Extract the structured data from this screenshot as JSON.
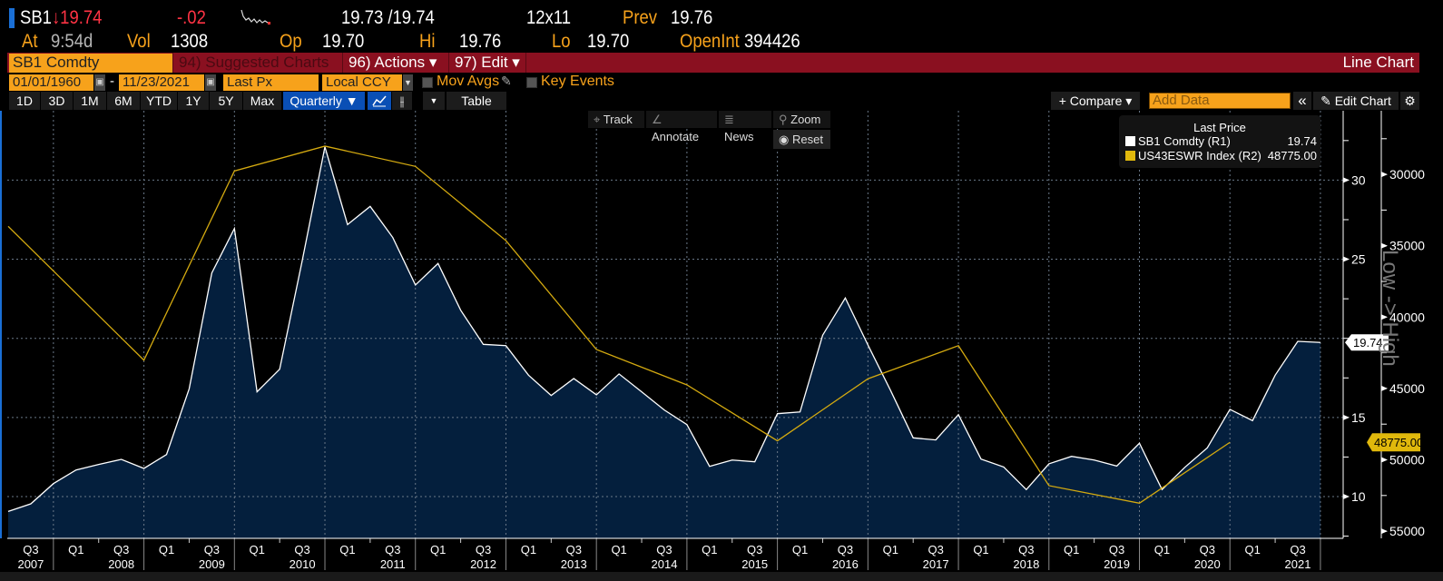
{
  "quote": {
    "ticker": "SB1",
    "arrow": "↓",
    "last": "19.74",
    "change": "-.02",
    "bid_ask": "19.73 /19.74",
    "size": "12x11",
    "prev_label": "Prev",
    "prev": "19.76",
    "at_label": "At",
    "time": "9:54d",
    "vol_label": "Vol",
    "vol": "1308",
    "op_label": "Op",
    "op": "19.70",
    "hi_label": "Hi",
    "hi": "19.76",
    "lo_label": "Lo",
    "lo": "19.70",
    "openint_label": "OpenInt",
    "openint": "394426"
  },
  "menubar": {
    "security": "SB1 Comdty",
    "suggested": "94) Suggested Charts",
    "actions": "96) Actions ▾",
    "edit": "97) Edit ▾",
    "chart_type": "Line Chart"
  },
  "settings": {
    "start_date": "01/01/1960",
    "dash": "-",
    "end_date": "11/23/2021",
    "field": "Last Px",
    "currency": "Local CCY",
    "mov_avgs": "Mov Avgs",
    "key_events": "Key Events"
  },
  "periods": [
    "1D",
    "3D",
    "1M",
    "6M",
    "YTD",
    "1Y",
    "5Y",
    "Max"
  ],
  "frequency": "Quarterly ▼",
  "table_label": "Table",
  "compare_label": "+ Compare ▾",
  "add_data_placeholder": "Add Data",
  "collapse_label": "«",
  "edit_chart_label": "Edit Chart",
  "chart_tools": {
    "track": "Track",
    "annotate": "Annotate",
    "news": "News",
    "zoom": "Zoom",
    "reset": "Reset"
  },
  "legend": {
    "title": "Last Price",
    "items": [
      {
        "name": "SB1 Comdty  (R1)",
        "value": "19.74",
        "color": "#ffffff"
      },
      {
        "name": "US43ESWR Index  (R2)",
        "value": "48775.00",
        "color": "#e0b80c"
      }
    ]
  },
  "colors": {
    "accent_orange": "#f7a21b",
    "bar_red": "#8a1020",
    "area_fill": "#041f3d",
    "r1_line": "#ffffff",
    "r2_line": "#d4aa10",
    "selected_blue": "#0a4fb5"
  },
  "chart_data": {
    "type": "line",
    "grid": true,
    "legend_placement": "top-right",
    "x_ticks": [
      {
        "q": "Q3",
        "year": "2007"
      },
      {
        "q": "Q1",
        "year": "2008"
      },
      {
        "q": "Q3",
        "year": ""
      },
      {
        "q": "Q1",
        "year": "2009"
      },
      {
        "q": "Q3",
        "year": ""
      },
      {
        "q": "Q1",
        "year": "2010"
      },
      {
        "q": "Q3",
        "year": ""
      },
      {
        "q": "Q1",
        "year": "2011"
      },
      {
        "q": "Q3",
        "year": ""
      },
      {
        "q": "Q1",
        "year": "2012"
      },
      {
        "q": "Q3",
        "year": ""
      },
      {
        "q": "Q1",
        "year": "2013"
      },
      {
        "q": "Q3",
        "year": ""
      },
      {
        "q": "Q1",
        "year": "2014"
      },
      {
        "q": "Q3",
        "year": ""
      },
      {
        "q": "Q1",
        "year": "2015"
      },
      {
        "q": "Q3",
        "year": ""
      },
      {
        "q": "Q1",
        "year": "2016"
      },
      {
        "q": "Q3",
        "year": ""
      },
      {
        "q": "Q1",
        "year": "2017"
      },
      {
        "q": "Q3",
        "year": ""
      },
      {
        "q": "Q1",
        "year": "2018"
      },
      {
        "q": "Q3",
        "year": ""
      },
      {
        "q": "Q1",
        "year": "2019"
      },
      {
        "q": "Q3",
        "year": ""
      },
      {
        "q": "Q1",
        "year": "2020"
      },
      {
        "q": "Q3",
        "year": ""
      },
      {
        "q": "Q1",
        "year": "2021"
      },
      {
        "q": "Q3",
        "year": ""
      }
    ],
    "r1_axis": {
      "ticks": [
        "30",
        "25",
        "15",
        "10"
      ],
      "ylim": [
        7.5,
        32.5
      ]
    },
    "r2_axis": {
      "ticks": [
        "30000",
        "35000",
        "40000",
        "45000",
        "50000",
        "55000"
      ],
      "inverted": true,
      "label": "Low -> High"
    },
    "series": [
      {
        "name": "SB1 Comdty (R1)",
        "axis": "R1",
        "style": "area",
        "last_tag": "19.74",
        "x": [
          "2007-Q2",
          "2007-Q3",
          "2007-Q4",
          "2008-Q1",
          "2008-Q2",
          "2008-Q3",
          "2008-Q4",
          "2009-Q1",
          "2009-Q2",
          "2009-Q3",
          "2009-Q4",
          "2010-Q1",
          "2010-Q2",
          "2010-Q3",
          "2010-Q4",
          "2011-Q1",
          "2011-Q2",
          "2011-Q3",
          "2011-Q4",
          "2012-Q1",
          "2012-Q2",
          "2012-Q3",
          "2012-Q4",
          "2013-Q1",
          "2013-Q2",
          "2013-Q3",
          "2013-Q4",
          "2014-Q1",
          "2014-Q2",
          "2014-Q3",
          "2014-Q4",
          "2015-Q1",
          "2015-Q2",
          "2015-Q3",
          "2015-Q4",
          "2016-Q1",
          "2016-Q2",
          "2016-Q3",
          "2016-Q4",
          "2017-Q1",
          "2017-Q2",
          "2017-Q3",
          "2017-Q4",
          "2018-Q1",
          "2018-Q2",
          "2018-Q3",
          "2018-Q4",
          "2019-Q1",
          "2019-Q2",
          "2019-Q3",
          "2019-Q4",
          "2020-Q1",
          "2020-Q2",
          "2020-Q3",
          "2020-Q4",
          "2021-Q1",
          "2021-Q2",
          "2021-Q3",
          "2021-Q4"
        ],
        "values": [
          9.06,
          9.54,
          10.82,
          11.68,
          12.03,
          12.35,
          11.78,
          12.66,
          16.81,
          24.13,
          26.94,
          16.62,
          18.05,
          24.93,
          32.1,
          27.19,
          28.34,
          26.37,
          23.37,
          24.73,
          21.78,
          19.62,
          19.54,
          17.67,
          16.39,
          17.46,
          16.43,
          17.75,
          16.62,
          15.47,
          14.55,
          11.91,
          12.31,
          12.2,
          15.24,
          15.35,
          20.2,
          22.55,
          19.58,
          16.71,
          13.71,
          13.58,
          15.18,
          12.37,
          11.87,
          10.44,
          12.07,
          12.54,
          12.31,
          11.93,
          13.37,
          10.44,
          11.84,
          13.08,
          15.51,
          14.8,
          17.67,
          19.81,
          19.74
        ]
      },
      {
        "name": "US43ESWR Index (R2)",
        "axis": "R2",
        "style": "line",
        "last_tag": "48775.00",
        "x": [
          "2007-Q2",
          "2008-Q4",
          "2009-Q4",
          "2010-Q4",
          "2011-Q4",
          "2012-Q4",
          "2013-Q4",
          "2014-Q4",
          "2015-Q4",
          "2016-Q4",
          "2017-Q4",
          "2018-Q4",
          "2019-Q4",
          "2020-Q4"
        ],
        "values": [
          33640,
          43020,
          29760,
          28020,
          29440,
          34640,
          42270,
          44750,
          48670,
          44320,
          42000,
          51810,
          53040,
          48775
        ]
      }
    ]
  }
}
